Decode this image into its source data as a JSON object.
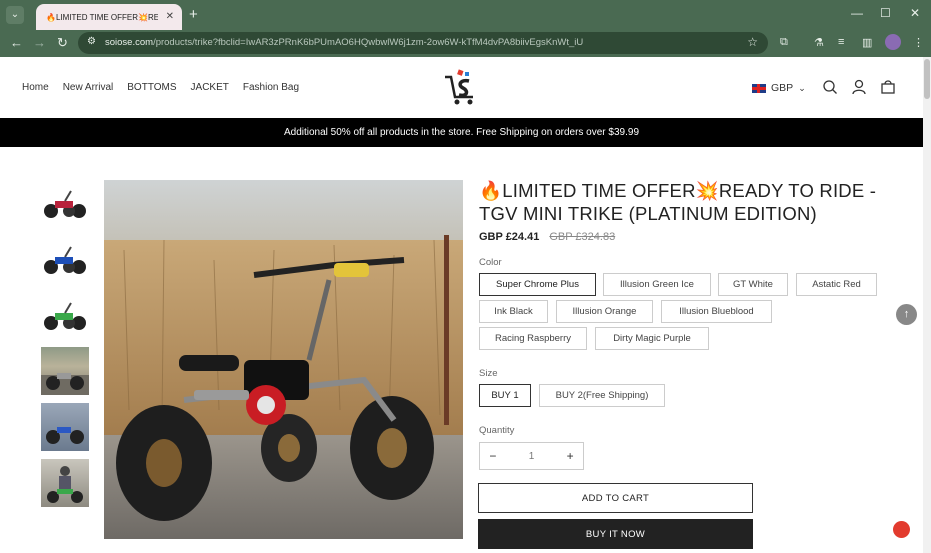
{
  "browser": {
    "tab_title": "🔥LIMITED TIME OFFER💥READY TO RIDE",
    "url_host": "soiose.com",
    "url_path": "/products/trike?fbclid=IwAR3zPRnK6bPUmAO6HQwbwlW6j1zm-2ow6W-kTfM4dvPA8biivEgsKnWt_iU",
    "icons": [
      "tab-menu-icon",
      "close-icon",
      "new-tab-icon",
      "minimize-icon",
      "maximize-icon",
      "window-close-icon",
      "back-icon",
      "forward-icon",
      "reload-icon",
      "site-info-icon",
      "bookmark-star-icon",
      "extensions-icon",
      "labs-icon",
      "reading-list-icon",
      "side-panel-icon",
      "profile-avatar",
      "more-menu-icon"
    ]
  },
  "site": {
    "menu": [
      "Home",
      "New Arrival",
      "BOTTOMS",
      "JACKET",
      "Fashion Bag"
    ],
    "currency": "GBP",
    "banner": "Additional 50% off all products in the store. Free Shipping on orders over $39.99"
  },
  "product": {
    "title": "🔥LIMITED TIME OFFER💥READY TO RIDE - TGV MINI TRIKE (PLATINUM EDITION)",
    "price": "GBP £24.41",
    "compare_price": "GBP £324.83",
    "color_label": "Color",
    "colors": [
      "Super Chrome Plus",
      "Illusion Green Ice",
      "GT White",
      "Astatic Red",
      "Ink Black",
      "Illusion Orange",
      "Illusion Blueblood",
      "Racing Raspberry",
      "Dirty Magic Purple"
    ],
    "selected_color": "Super Chrome Plus",
    "size_label": "Size",
    "sizes": [
      "BUY 1",
      "BUY 2(Free Shipping)"
    ],
    "selected_size": "BUY 1",
    "quantity_label": "Quantity",
    "quantity": "1",
    "qty_minus": "−",
    "qty_plus": "+",
    "add_to_cart": "ADD TO CART",
    "buy_now": "BUY IT NOW"
  },
  "colors": {
    "chrome": "#4a6a52",
    "omnibox": "#2f4935",
    "banner": "#000000",
    "buy_now": "#222222"
  }
}
